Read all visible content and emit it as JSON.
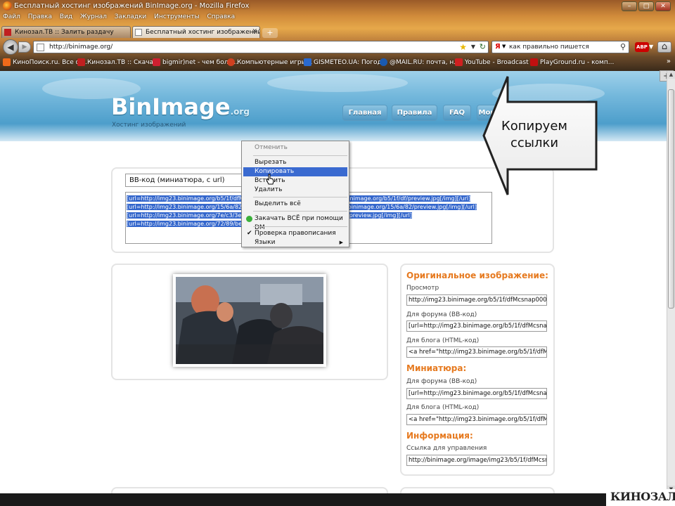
{
  "window": {
    "title": "Бесплатный хостинг изображений BinImage.org - Mozilla Firefox",
    "controls": {
      "minimize": "–",
      "maximize": "□",
      "close": "✕"
    }
  },
  "menu": [
    "Файл",
    "Правка",
    "Вид",
    "Журнал",
    "Закладки",
    "Инструменты",
    "Справка"
  ],
  "tabs": [
    {
      "label": "Кинозал.ТВ :: Залить раздачу",
      "active": false
    },
    {
      "label": "Бесплатный хостинг изображений BinI...",
      "active": true
    }
  ],
  "navbar": {
    "url": "http://binimage.org/",
    "search_engine": "Я",
    "search_text": "как правильно пишется"
  },
  "bookmarks": [
    {
      "label": "КиноПоиск.ru. Все ф...",
      "icon": "kinopoisk-icon",
      "color": "#f06a1a"
    },
    {
      "label": "Кинозал.ТВ :: Скача...",
      "icon": "kinozal-icon",
      "color": "#c02020"
    },
    {
      "label": "bigmir)net - чем боль...",
      "icon": "bigmir-icon",
      "color": "#d02030"
    },
    {
      "label": "Компьютерные игры...",
      "icon": "games-icon",
      "color": "#d04020"
    },
    {
      "label": "GISMETEO.UA: Погод...",
      "icon": "gismeteo-icon",
      "color": "#2a6ad0"
    },
    {
      "label": "@MAIL.RU: почта, н...",
      "icon": "mailru-icon",
      "color": "#1a5ab0"
    },
    {
      "label": "YouTube - Broadcast ...",
      "icon": "youtube-icon",
      "color": "#d02020"
    },
    {
      "label": "PlayGround.ru - комп...",
      "icon": "playground-icon",
      "color": "#c01010"
    }
  ],
  "site": {
    "logo": "BinImage",
    "logo_suffix": ".org",
    "tagline": "Хостинг изображений",
    "nav": [
      "Главная",
      "Правила",
      "FAQ",
      "Мои изображения"
    ]
  },
  "code": {
    "selected_format": "BB-код (миниатюра, с url)",
    "lines": [
      "[url=http://img23.binimage.org/b5/1f/dfMcsnap00001.png][img]http://img23.binimage.org/b5/1f/df/preview.jpg[/img][/url]",
      "[url=http://img23.binimage.org/15/6a/82Mcsnap00002.png][img]http://img23.binimage.org/15/6a/82/preview.jpg[/img][/url]",
      "[url=http://img23.binimage.org/7e/c3/3eM       0000                                     img23.binimage.org/7e/c3/3e/preview.jpg[/img][/url]",
      "[url=http://img23.binimage.org/72/89/be/                                                         .org/72/89/be/preview.jpg[/img][/url]"
    ]
  },
  "callout": {
    "line1": "Копируем",
    "line2": "ссылки"
  },
  "context_menu": {
    "items": [
      {
        "label": "Отменить",
        "state": "normal"
      },
      {
        "label": "Вырезать",
        "state": "normal"
      },
      {
        "label": "Копировать",
        "state": "highlighted"
      },
      {
        "label": "Вставить",
        "state": "normal"
      },
      {
        "label": "Удалить",
        "state": "normal"
      },
      {
        "label": "Выделить всё",
        "state": "normal"
      },
      {
        "label": "Закачать ВСЁ при помощи DM",
        "state": "normal"
      },
      {
        "label": "Проверка правописания",
        "state": "checked"
      },
      {
        "label": "Языки",
        "state": "submenu"
      }
    ],
    "check_glyph": "✔",
    "submenu_glyph": "▶"
  },
  "info": {
    "original_heading": "Оригинальное изображение:",
    "view_label": "Просмотр",
    "view_value": "http://img23.binimage.org/b5/1f/dfMcsnap0000'",
    "forum_label": "Для форума (BB-код)",
    "forum_value": "[url=http://img23.binimage.org/b5/1f/dfMcsnap0",
    "blog_label": "Для блога (HTML-код)",
    "blog_value": "<a href=\"http://img23.binimage.org/b5/1f/dfMcsr",
    "thumb_heading": "Миниатюра:",
    "thumb_forum_label": "Для форума (BB-код)",
    "thumb_forum_value": "[url=http://img23.binimage.org/b5/1f/dfMcsnap0",
    "thumb_blog_label": "Для блога (HTML-код)",
    "thumb_blog_value": "<a href=\"http://img23.binimage.org/b5/1f/dfMcsr",
    "info_heading": "Информация:",
    "manage_label": "Ссылка для управления",
    "manage_value": "http://binimage.org/image/img23/b5/1f/dfMcsna"
  },
  "watermark": "КИНОЗАЛ.ТВ",
  "colors": {
    "accent_orange": "#e67a20",
    "selection_blue": "#3366cc",
    "menu_highlight": "#3a6ad0"
  }
}
